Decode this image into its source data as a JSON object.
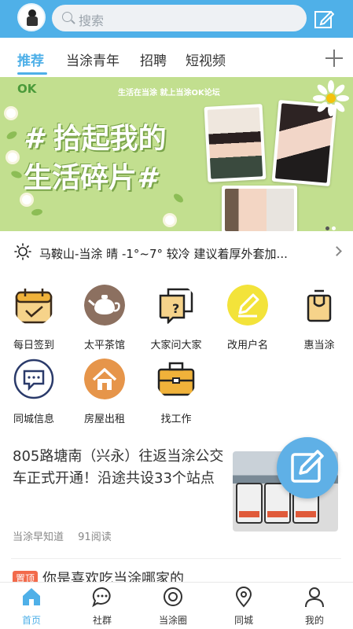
{
  "header": {
    "search_placeholder": "搜索"
  },
  "tabs": [
    {
      "label": "推荐",
      "active": true
    },
    {
      "label": "当涂青年"
    },
    {
      "label": "招聘"
    },
    {
      "label": "短视频"
    }
  ],
  "banner": {
    "logo": "OK",
    "slogan": "生活在当涂  就上当涂OK论坛",
    "headline_line1": "拾起我的",
    "headline_line2": "生活碎片",
    "hash": "#"
  },
  "weather": {
    "text": "马鞍山-当涂 晴 -1°~7° 较冷 建议着厚外套加..."
  },
  "grid": [
    {
      "label": "每日签到",
      "icon": "calendar-check-icon"
    },
    {
      "label": "太平茶馆",
      "icon": "teapot-icon"
    },
    {
      "label": "大家问大家",
      "icon": "question-cards-icon"
    },
    {
      "label": "改用户名",
      "icon": "pencil-icon"
    },
    {
      "label": "惠当涂",
      "icon": "shopping-bag-icon"
    },
    {
      "label": "同城信息",
      "icon": "chat-bubble-icon"
    },
    {
      "label": "房屋出租",
      "icon": "house-icon"
    },
    {
      "label": "找工作",
      "icon": "briefcase-icon"
    }
  ],
  "feed": {
    "title": "805路塘南（兴永）往返当涂公交车正式开通！沿途共设33个站点",
    "source": "当涂早知道",
    "reads": "91阅读",
    "next_badge": "置顶",
    "next_title": "你是喜欢吃当涂哪家的"
  },
  "bottom_nav": [
    {
      "label": "首页",
      "active": true
    },
    {
      "label": "社群"
    },
    {
      "label": "当涂圈"
    },
    {
      "label": "同城"
    },
    {
      "label": "我的"
    }
  ],
  "colors": {
    "accent": "#4fb0e8",
    "banner_bg": "#c2df8f"
  }
}
